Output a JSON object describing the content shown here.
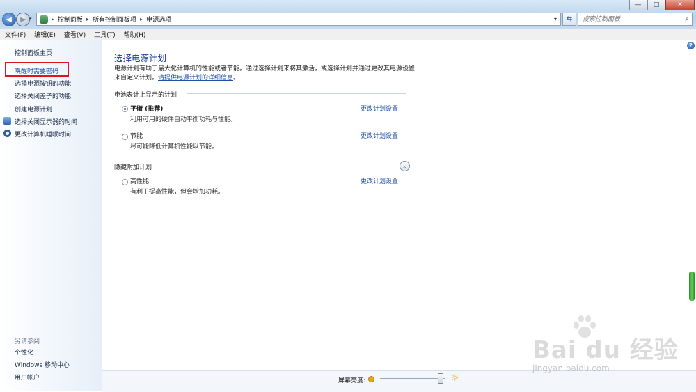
{
  "window": {
    "controls": {
      "minimize": "—",
      "maximize": "□",
      "close": "✕"
    }
  },
  "nav": {
    "back_icon": "◀",
    "forward_icon": "▶",
    "dropdown_icon": "▾"
  },
  "breadcrumb": {
    "items": [
      "控制面板",
      "所有控制面板项",
      "电源选项"
    ],
    "separator": "▸"
  },
  "search": {
    "placeholder": "搜索控制面板"
  },
  "menu": [
    "文件(F)",
    "编辑(E)",
    "查看(V)",
    "工具(T)",
    "帮助(H)"
  ],
  "sidebar": {
    "home": "控制面板主页",
    "items": [
      "唤醒时需要密码",
      "选择电源按钮的功能",
      "选择关闭盖子的功能",
      "创建电源计划",
      "选择关闭显示器的时间",
      "更改计算机睡眠时间"
    ],
    "see_also_label": "另请参阅",
    "see_also": [
      "个性化",
      "Windows 移动中心",
      "用户帐户"
    ]
  },
  "main": {
    "title": "选择电源计划",
    "description_line1": "电源计划有助于最大化计算机的性能或者节能。通过选择计划来将其激活，或选择计划并通过更改其电源设置",
    "description_line2_prefix": "来自定义计划。",
    "description_link": "请提供电源计划的详细信息",
    "description_suffix": "。",
    "section_battery": "电池表计上显示的计划",
    "section_hidden": "隐藏附加计划",
    "change_label": "更改计划设置",
    "plans": [
      {
        "name": "平衡 (推荐)",
        "desc": "利用可用的硬件自动平衡功耗与性能。",
        "selected": true
      },
      {
        "name": "节能",
        "desc": "尽可能降低计算机性能以节能。",
        "selected": false
      },
      {
        "name": "高性能",
        "desc": "有利于提高性能，但会增加功耗。",
        "selected": false
      }
    ]
  },
  "brightness": {
    "label": "屏幕亮度:",
    "level": 0.93
  },
  "watermark": {
    "text": "Bai du 经验",
    "url": "jingyan.baidu.com"
  },
  "colors": {
    "title_blue": "#1a3c8f",
    "link_blue": "#1e50a6",
    "highlight_red": "#e0141c"
  }
}
